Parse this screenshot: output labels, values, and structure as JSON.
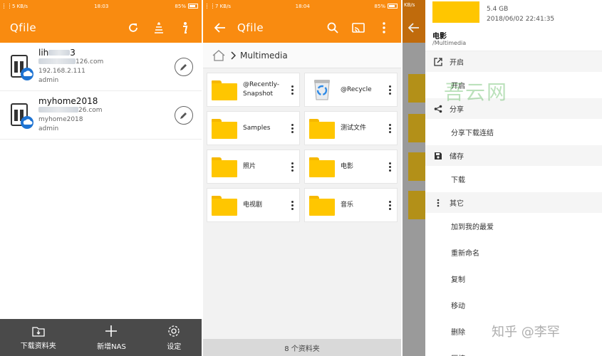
{
  "panel1": {
    "status": {
      "speed": "5 KB/s",
      "time": "18:03",
      "battery": "85%"
    },
    "title": "Qfile",
    "nas_list": [
      {
        "name": "lih",
        "name_tail": "3",
        "host_tail": "126.com",
        "ip": "192.168.2.111",
        "user": "admin"
      },
      {
        "name": "myhome2018",
        "host_tail": "26.com",
        "ip": "myhome2018",
        "user": "admin"
      }
    ],
    "bottom": [
      {
        "label": "下载资料夹",
        "icon": "download-folder-icon"
      },
      {
        "label": "新增NAS",
        "icon": "plus-icon"
      },
      {
        "label": "设定",
        "icon": "gear-icon"
      }
    ]
  },
  "panel2": {
    "status": {
      "speed": "7 KB/s",
      "time": "18:04",
      "battery": "85%"
    },
    "title": "Qfile",
    "breadcrumb": "Multimedia",
    "folders": [
      {
        "label": "@Recently-Snapshot",
        "icon": "folder-icon"
      },
      {
        "label": "@Recycle",
        "icon": "recycle-bin-icon"
      },
      {
        "label": "Samples",
        "icon": "folder-icon"
      },
      {
        "label": "测试文件",
        "icon": "folder-icon"
      },
      {
        "label": "照片",
        "icon": "folder-icon"
      },
      {
        "label": "电影",
        "icon": "folder-icon"
      },
      {
        "label": "电视剧",
        "icon": "folder-icon"
      },
      {
        "label": "音乐",
        "icon": "folder-icon"
      }
    ],
    "footer": "8 个资料夹"
  },
  "panel3": {
    "status": {
      "speed": "KB/s"
    },
    "file": {
      "size": "5.4 GB",
      "date": "2018/06/02 22:41:35",
      "name": "电影",
      "path": "/Multimedia"
    },
    "sections": [
      {
        "title": "开启",
        "icon": "open-external-icon",
        "items": [
          "开启"
        ]
      },
      {
        "title": "分享",
        "icon": "share-icon",
        "items": [
          "分享下载连结"
        ]
      },
      {
        "title": "储存",
        "icon": "save-icon",
        "items": [
          "下载"
        ]
      },
      {
        "title": "其它",
        "icon": "more-vertical-icon",
        "items": [
          "加到我的最爱",
          "重新命名",
          "复制",
          "移动",
          "删除",
          "压缩"
        ]
      }
    ]
  },
  "watermarks": {
    "site": "吾云网",
    "author": "知乎 @李罕"
  },
  "colors": {
    "accent": "#f98b10",
    "folder": "#ffc600",
    "bottom_bar": "#4a4a4a"
  }
}
